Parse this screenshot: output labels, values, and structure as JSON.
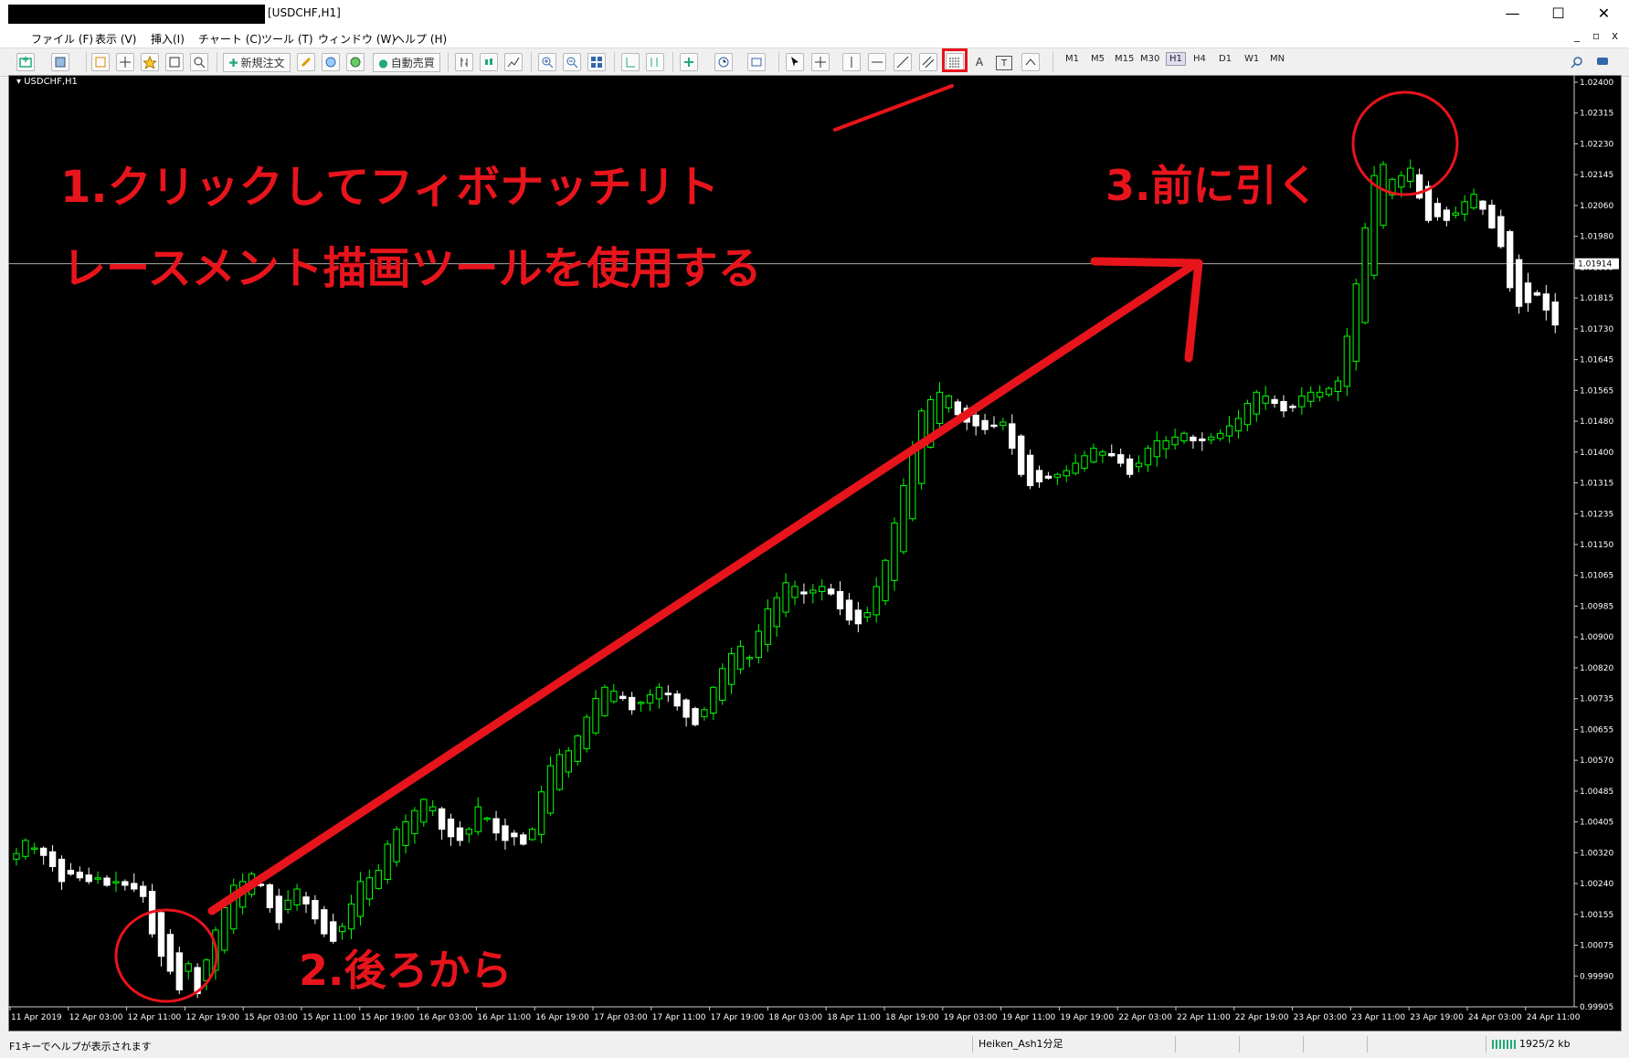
{
  "window": {
    "title": "[USDCHF,H1]",
    "minimize": "—",
    "maximize": "☐",
    "close": "✕"
  },
  "menu": {
    "items": [
      "ファイル (F)",
      "表示 (V)",
      "挿入(I)",
      "チャート (C)",
      "ツール (T)",
      "ウィンドウ (W)",
      "ヘルプ (H)"
    ],
    "mdi_min": "_",
    "mdi_restore": "▫",
    "mdi_close": "x"
  },
  "toolbar": {
    "new_order": "新規注文",
    "auto_trade": "自動売買",
    "text_tool": "A",
    "label_tool": "T",
    "timeframes": [
      "M1",
      "M5",
      "M15",
      "M30",
      "H1",
      "H4",
      "D1",
      "W1",
      "MN"
    ],
    "active_timeframe": "H1"
  },
  "chart": {
    "symbol_label": "USDCHF,H1",
    "current_price": "1.01914",
    "price_axis": [
      "1.02400",
      "1.02315",
      "1.02230",
      "1.02145",
      "1.02060",
      "1.01980",
      "1.01895",
      "1.01815",
      "1.01730",
      "1.01645",
      "1.01565",
      "1.01480",
      "1.01400",
      "1.01315",
      "1.01235",
      "1.01150",
      "1.01065",
      "1.00985",
      "1.00900",
      "1.00820",
      "1.00735",
      "1.00655",
      "1.00570",
      "1.00485",
      "1.00405",
      "1.00320",
      "1.00240",
      "1.00155",
      "1.00075",
      "0.99990",
      "0.99905"
    ],
    "time_axis": [
      "11 Apr 2019",
      "12 Apr 03:00",
      "12 Apr 11:00",
      "12 Apr 19:00",
      "15 Apr 03:00",
      "15 Apr 11:00",
      "15 Apr 19:00",
      "16 Apr 03:00",
      "16 Apr 11:00",
      "16 Apr 19:00",
      "17 Apr 03:00",
      "17 Apr 11:00",
      "17 Apr 19:00",
      "18 Apr 03:00",
      "18 Apr 11:00",
      "18 Apr 19:00",
      "19 Apr 03:00",
      "19 Apr 11:00",
      "19 Apr 19:00",
      "22 Apr 03:00",
      "22 Apr 11:00",
      "22 Apr 19:00",
      "23 Apr 03:00",
      "23 Apr 11:00",
      "23 Apr 19:00",
      "24 Apr 03:00",
      "24 Apr 11:00"
    ]
  },
  "annotations": {
    "step1_line1": "1.クリックしてフィボナッチリト",
    "step1_line2": "レースメント描画ツールを使用する",
    "step2": "2.後ろから",
    "step3": "3.前に引く"
  },
  "status": {
    "help": "F1キーでヘルプが表示されます",
    "profile": "Heiken_Ash1分足",
    "connection": "1925/2 kb"
  },
  "colors": {
    "annotation": "#e8141c",
    "bull": "#00ff00",
    "bear": "#ffffff",
    "background": "#000000"
  },
  "chart_data": {
    "type": "candlestick",
    "symbol": "USDCHF",
    "timeframe": "H1",
    "x_start": "11 Apr 2019",
    "x_end": "24 Apr 11:00",
    "ylim": [
      0.99905,
      1.024
    ],
    "close": [
      1.00335,
      1.0037,
      1.0035,
      1.0033,
      1.003,
      1.0026,
      1.0028,
      1.0027,
      1.0026,
      1.0027,
      1.0025,
      1.0026,
      1.0025,
      1.0024,
      1.0022,
      1.0012,
      1.0006,
      1.0002,
      0.9997,
      1.0004,
      0.9996,
      1.0005,
      1.0013,
      1.0019,
      1.0025,
      1.0026,
      1.0028,
      1.0025,
      1.0019,
      1.0015,
      1.0021,
      1.0024,
      1.002,
      1.0016,
      1.0012,
      1.001,
      1.0014,
      1.002,
      1.0026,
      1.0027,
      1.0029,
      1.0036,
      1.004,
      1.0042,
      1.0045,
      1.0048,
      1.0046,
      1.004,
      1.0038,
      1.0037,
      1.004,
      1.0046,
      1.0043,
      1.0039,
      1.0037,
      1.0038,
      1.0036,
      1.004,
      1.005,
      1.0057,
      1.006,
      1.0061,
      1.0065,
      1.007,
      1.0075,
      1.0078,
      1.0077,
      1.0075,
      1.0072,
      1.0074,
      1.0076,
      1.0078,
      1.0076,
      1.0073,
      1.007,
      1.0068,
      1.0072,
      1.0078,
      1.0083,
      1.0087,
      1.0089,
      1.0086,
      1.0093,
      1.0099,
      1.0102,
      1.0106,
      1.0105,
      1.0103,
      1.0104,
      1.0105,
      1.0103,
      1.0099,
      1.0096,
      1.0095,
      1.0098,
      1.0105,
      1.0112,
      1.0122,
      1.0132,
      1.0142,
      1.0152,
      1.0155,
      1.0157,
      1.0156,
      1.0151,
      1.0149,
      1.0148,
      1.0147,
      1.0148,
      1.0149,
      1.0142,
      1.0135,
      1.0132,
      1.0133,
      1.0134,
      1.0135,
      1.0136,
      1.0138,
      1.014,
      1.0142,
      1.0141,
      1.014,
      1.0138,
      1.0135,
      1.0138,
      1.0142,
      1.0144,
      1.0144,
      1.0145,
      1.0146,
      1.0144,
      1.0144,
      1.0145,
      1.0146,
      1.0148,
      1.015,
      1.0154,
      1.0157,
      1.0156,
      1.0154,
      1.0152,
      1.0153,
      1.0156,
      1.0157,
      1.0157,
      1.0158,
      1.016,
      1.0172,
      1.0186,
      1.0201,
      1.0215,
      1.0218,
      1.0214,
      1.0215,
      1.0217,
      1.0209,
      1.0203,
      1.0204,
      1.0203,
      1.0205,
      1.0208,
      1.021,
      1.0206,
      1.0201,
      1.0196,
      1.0185,
      1.018,
      1.0181,
      1.0183,
      1.0179,
      1.0175
    ]
  }
}
